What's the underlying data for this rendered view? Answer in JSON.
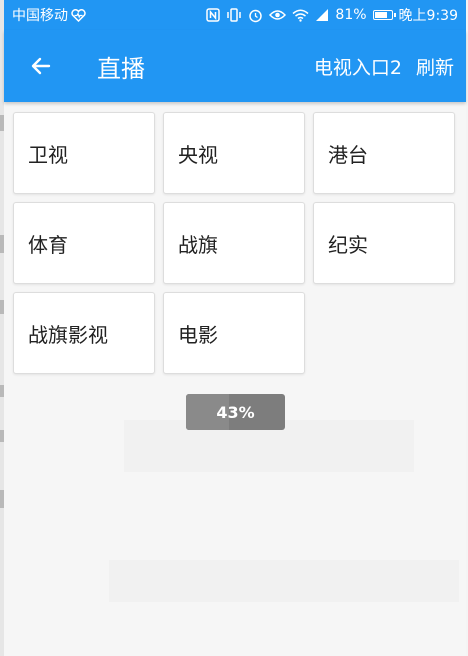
{
  "status_bar": {
    "carrier": "中国移动",
    "battery_percent": "81%",
    "time": "晚上9:39",
    "battery_level": 0.81
  },
  "toolbar": {
    "back_icon": "arrow-left-icon",
    "title": "直播",
    "actions": [
      "电视入口2",
      "刷新"
    ]
  },
  "categories": [
    "卫视",
    "央视",
    "港台",
    "体育",
    "战旗",
    "纪实",
    "战旗影视",
    "电影"
  ],
  "progress": {
    "label": "43%",
    "value": 0.43
  },
  "colors": {
    "primary": "#2196f3",
    "background": "#f6f6f6",
    "card": "#ffffff",
    "progress_bg": "#7d7d7d"
  }
}
